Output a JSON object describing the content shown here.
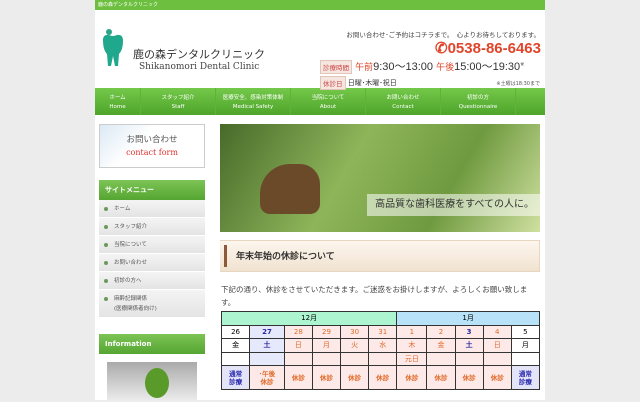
{
  "topbar": "鹿の森デンタルクリニック",
  "header": {
    "name_jp": "鹿の森デンタルクリニック",
    "name_en": "Shikanomori Dental Clinic",
    "contact_msg": "お問い合わせ･ご予約はコチラまで。　心よりお待ちしております。",
    "phone": "0538-86-6463",
    "hours_label": "診療時間",
    "am_label": "午前",
    "am_hours": "9:30〜13:00",
    "pm_label": "午後",
    "pm_hours": "15:00〜19:30",
    "mark": "※",
    "closed_label": "休診日",
    "closed_days": "日曜･木曜･祝日",
    "sat_note": "※土曜は18:30まで"
  },
  "nav": [
    {
      "jp": "ホーム",
      "en": "Home"
    },
    {
      "jp": "スタッフ紹介",
      "en": "Staff"
    },
    {
      "jp": "医療安全、感染対策体制",
      "en": "Medical Safety"
    },
    {
      "jp": "当院について",
      "en": "About"
    },
    {
      "jp": "お問い合わせ",
      "en": "Contact"
    },
    {
      "jp": "初診の方",
      "en": "Questionnaire"
    }
  ],
  "sidebar": {
    "contact_jp": "お問い合わせ",
    "contact_en": "contact form",
    "menu_title": "サイトメニュー",
    "menu": [
      "ホーム",
      "スタッフ紹介",
      "当院について",
      "お問い合わせ",
      "初診の方へ",
      "麻酔記録関係",
      "(医療関係者向け)"
    ],
    "info_title": "Information"
  },
  "hero": {
    "caption": "高品質な歯科医療をすべての人に。"
  },
  "main": {
    "heading": "年末年始の休診について",
    "text": "下記の通り、休診をさせていただきます。ご迷惑をお掛けしますが、よろしくお願い致します。",
    "months": [
      "12月",
      "1月"
    ],
    "days": [
      "26",
      "27",
      "28",
      "29",
      "30",
      "31",
      "1",
      "2",
      "3",
      "4",
      "5"
    ],
    "weekdays": [
      "金",
      "土",
      "日",
      "月",
      "火",
      "水",
      "木",
      "金",
      "土",
      "日",
      "月"
    ],
    "notes": [
      "",
      "",
      "",
      "",
      "",
      "",
      "元日",
      "",
      "",
      "",
      ""
    ],
    "status": [
      "通常\n診療",
      "･午後\n休診",
      "休診",
      "休診",
      "休診",
      "休診",
      "休診",
      "休診",
      "休診",
      "休診",
      "通常\n診療"
    ]
  }
}
